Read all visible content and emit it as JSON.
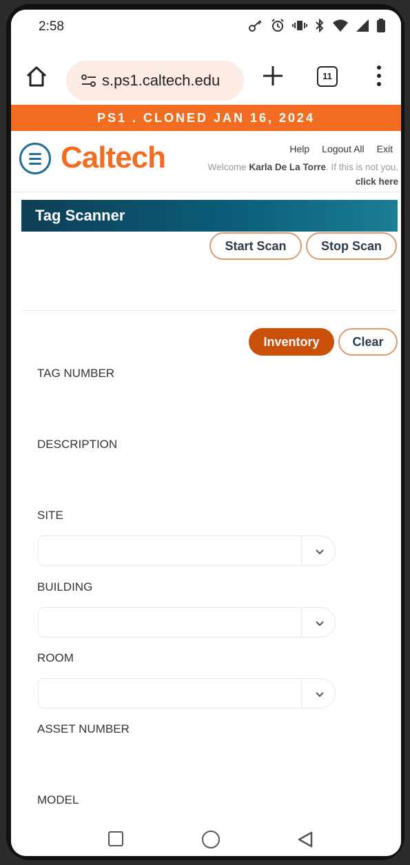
{
  "status_bar": {
    "time": "2:58",
    "icons": [
      "key-icon",
      "alarm-icon",
      "vibrate-icon",
      "bluetooth-icon",
      "wifi-icon",
      "signal-icon",
      "battery-icon"
    ]
  },
  "browser": {
    "url": "s.ps1.caltech.edu",
    "tab_count": "11"
  },
  "banner": {
    "text": "PS1 . CLONED JAN 16, 2024"
  },
  "header": {
    "logo": "Caltech",
    "links": [
      "Help",
      "Logout All",
      "Exit"
    ],
    "welcome_prefix": "Welcome ",
    "user_name": "Karla De La Torre",
    "welcome_suffix": ". If this is not you, ",
    "click_here": "click here"
  },
  "panel": {
    "title": "Tag Scanner",
    "start_scan": "Start Scan",
    "stop_scan": "Stop Scan",
    "inventory": "Inventory",
    "clear": "Clear"
  },
  "fields": {
    "tag_number": "TAG NUMBER",
    "description": "DESCRIPTION",
    "site": "SITE",
    "building": "BUILDING",
    "room": "ROOM",
    "asset_number": "ASSET NUMBER",
    "model": "MODEL"
  },
  "colors": {
    "accent_orange": "#f26d21",
    "inventory_button": "#c9510c",
    "panel_header": "#0b5d78"
  }
}
